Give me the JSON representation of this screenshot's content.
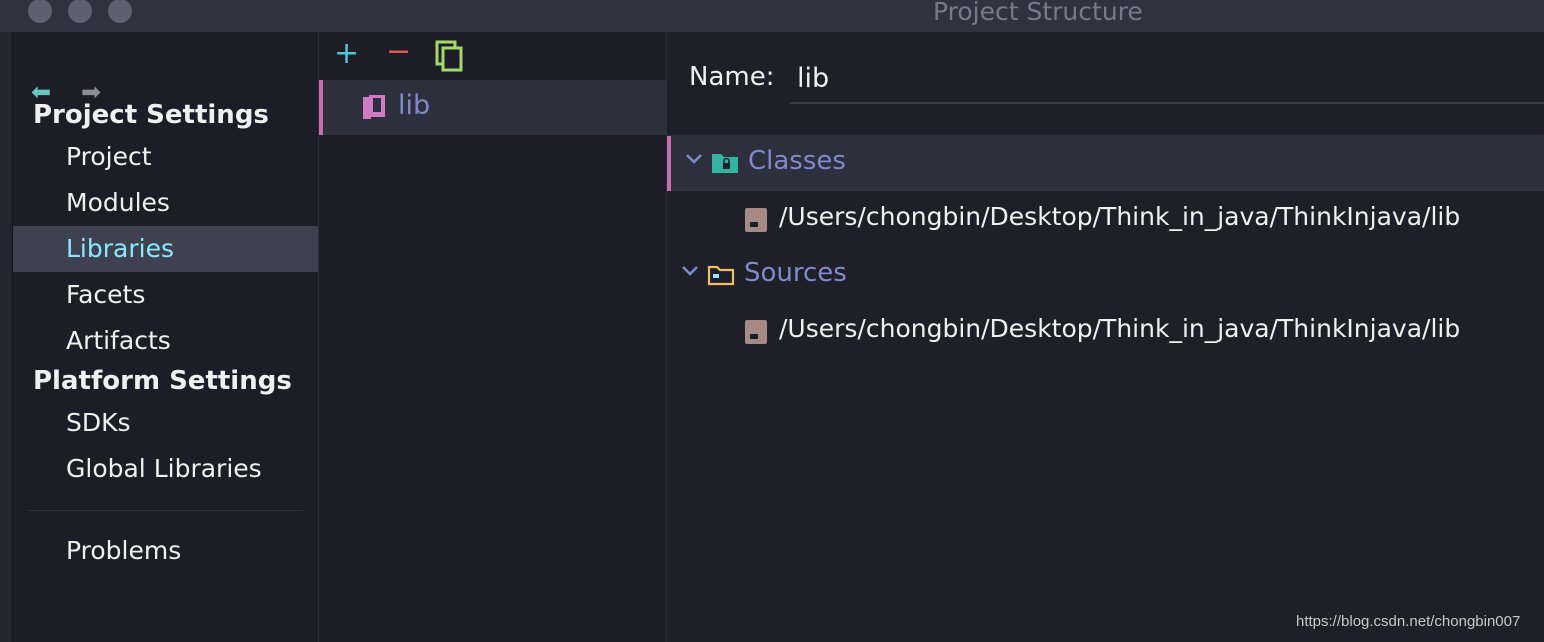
{
  "window": {
    "title": "Project Structure"
  },
  "navigation": {
    "back_icon": "arrow-left-icon",
    "forward_icon": "arrow-right-icon"
  },
  "sidebar": {
    "project_settings_heading": "Project Settings",
    "project_items": [
      {
        "label": "Project"
      },
      {
        "label": "Modules"
      },
      {
        "label": "Libraries",
        "selected": true
      },
      {
        "label": "Facets"
      },
      {
        "label": "Artifacts"
      }
    ],
    "platform_settings_heading": "Platform Settings",
    "platform_items": [
      {
        "label": "SDKs"
      },
      {
        "label": "Global Libraries"
      }
    ],
    "problems_label": "Problems"
  },
  "libraries_panel": {
    "toolbar": {
      "add_icon": "plus-icon",
      "remove_icon": "minus-icon",
      "copy_icon": "copy-icon"
    },
    "items": [
      {
        "label": "lib",
        "icon": "library-icon"
      }
    ]
  },
  "detail": {
    "name_label": "Name:",
    "name_value": "lib",
    "groups": [
      {
        "label": "Classes",
        "icon": "classes-folder-icon",
        "expanded": true,
        "paths": [
          "/Users/chongbin/Desktop/Think_in_java/ThinkInjava/lib"
        ]
      },
      {
        "label": "Sources",
        "icon": "sources-folder-icon",
        "expanded": true,
        "paths": [
          "/Users/chongbin/Desktop/Think_in_java/ThinkInjava/lib"
        ]
      }
    ]
  },
  "watermark": "https://blog.csdn.net/chongbin007",
  "colors": {
    "selection_bg": "#3f4150",
    "selected_text": "#8be9fd",
    "accent_pink": "#c96ea8",
    "group_label": "#7f8bc8",
    "add_green": "#50c8d0",
    "remove_red": "#e05a5a",
    "copy_green": "#a6d96a"
  }
}
